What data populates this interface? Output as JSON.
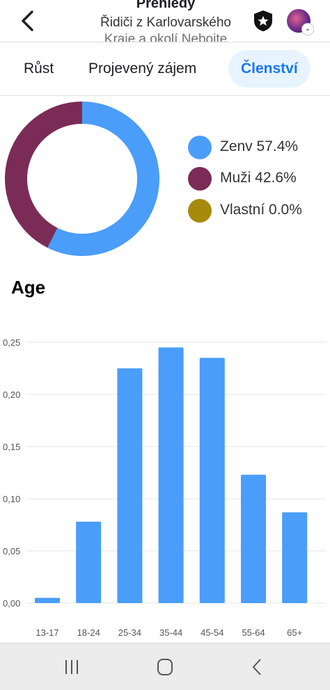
{
  "header": {
    "title": "Přehledy",
    "subtitle": "Řidiči z Karlovarského",
    "subtitle_line2": "Kraje a okolí Nebojte"
  },
  "tabs": [
    {
      "label": "Růst",
      "active": false
    },
    {
      "label": "Projevený zájem",
      "active": false
    },
    {
      "label": "Členství",
      "active": true
    }
  ],
  "gender": {
    "legend": [
      {
        "label": "Zenv 57.4%",
        "color": "#4a9df8"
      },
      {
        "label": "Muži 42.6%",
        "color": "#7a2c57"
      },
      {
        "label": "Vlastní 0.0%",
        "color": "#a68a0b"
      }
    ],
    "chart_data": {
      "type": "pie",
      "donut": true,
      "slices": [
        {
          "name": "Zenv",
          "value": 57.4,
          "color": "#4a9df8"
        },
        {
          "name": "Muži",
          "value": 42.6,
          "color": "#7a2c57"
        },
        {
          "name": "Vlastní",
          "value": 0.0,
          "color": "#a68a0b"
        }
      ]
    }
  },
  "age": {
    "title": "Age"
  },
  "chart_data": {
    "type": "bar",
    "categories": [
      "13-17",
      "18-24",
      "25-34",
      "35-44",
      "45-54",
      "55-64",
      "65+"
    ],
    "values": [
      0.005,
      0.078,
      0.225,
      0.245,
      0.235,
      0.123,
      0.087
    ],
    "yticks": [
      "0,00",
      "0,05",
      "0,10",
      "0,15",
      "0,20",
      "0,25"
    ],
    "ylim": [
      0,
      0.25
    ],
    "grid": true,
    "color": "#4a9df8"
  },
  "nav": {
    "recents_icon": "recents-icon",
    "home_icon": "home-icon",
    "back_icon": "back-icon"
  }
}
